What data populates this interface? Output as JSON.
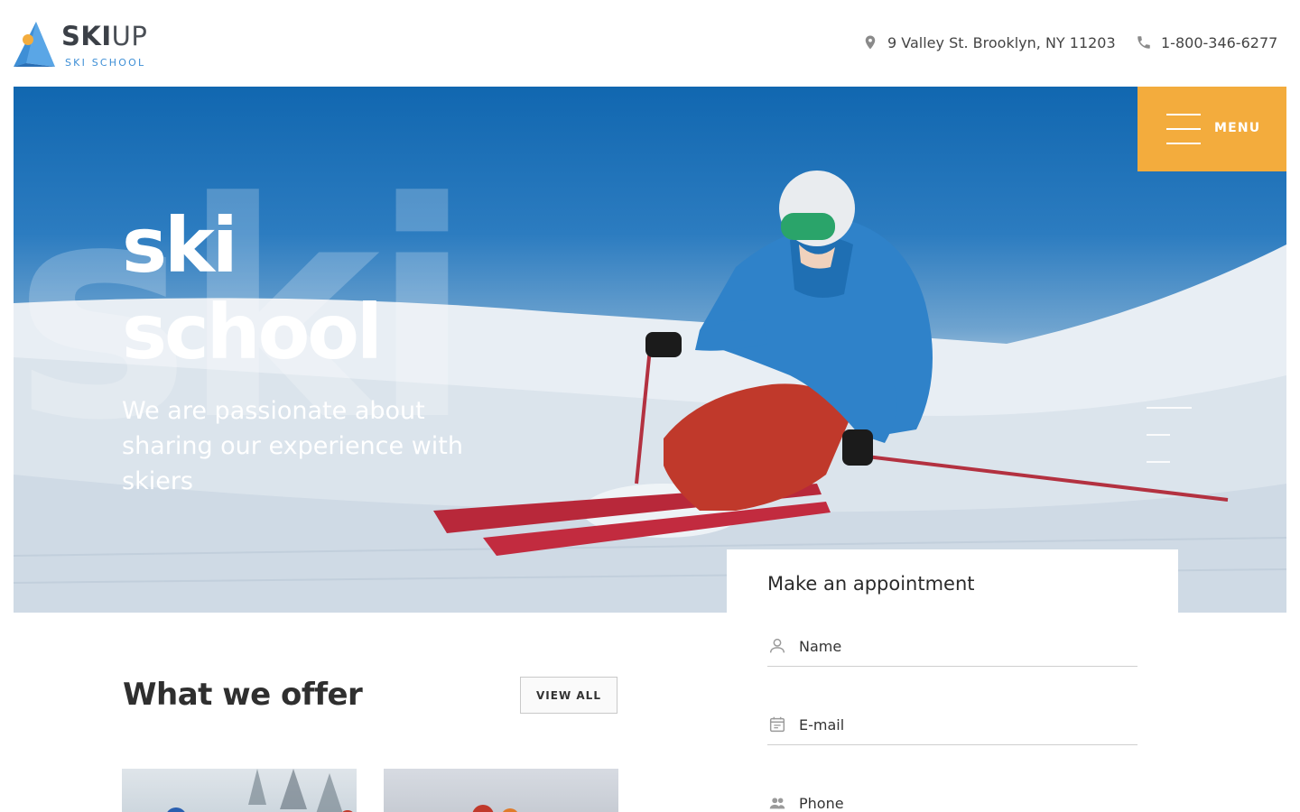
{
  "brand": {
    "name_bold": "SKI",
    "name_light": "UP",
    "tagline": "SKI SCHOOL",
    "colors": {
      "blue": "#3e8fd6",
      "orange": "#f3ac3d",
      "dark": "#3b4047"
    }
  },
  "header": {
    "address": "9 Valley St. Brooklyn, NY 11203",
    "phone": "1-800-346-6277",
    "address_icon": "map-pin-icon",
    "phone_icon": "phone-icon"
  },
  "hero": {
    "ghost_word": "ski",
    "title_line1": "ski",
    "title_line2": "school",
    "subtitle": "We are passionate about sharing our experience with skiers",
    "menu_label": "MENU",
    "menu_icon": "hamburger-icon"
  },
  "appointment": {
    "title": "Make an appointment",
    "fields": [
      {
        "placeholder": "Name",
        "icon": "person-icon"
      },
      {
        "placeholder": "E-mail",
        "icon": "calendar-icon"
      },
      {
        "placeholder": "Phone",
        "icon": "people-icon"
      }
    ]
  },
  "offer": {
    "title": "What we offer",
    "view_all": "VIEW ALL"
  }
}
